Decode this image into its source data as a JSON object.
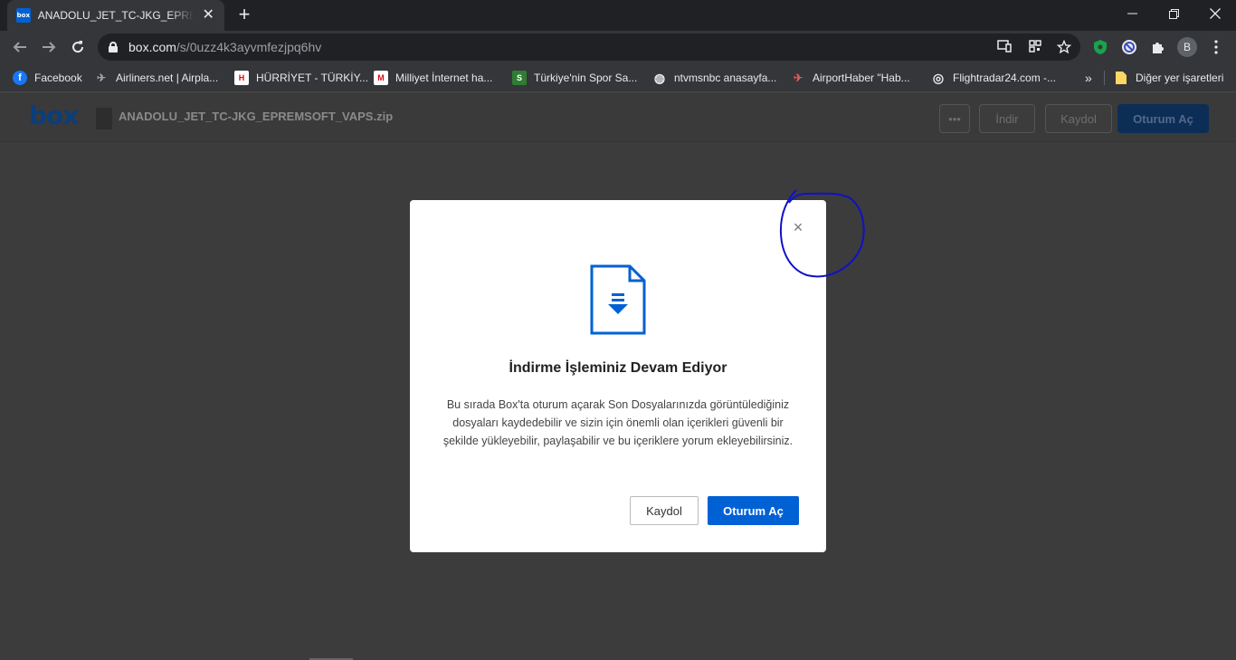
{
  "browser": {
    "tab_title": "ANADOLU_JET_TC-JKG_EPREMSOFT_VAPS.zip",
    "tab_favicon_text": "box",
    "new_tab_label": "+",
    "url_host": "box.com",
    "url_path": "/s/0uzz4k3ayvmfezjpq6hv",
    "avatar_letter": "B",
    "window_controls": {
      "minimize": "—",
      "maximize": "❐",
      "close": "✕"
    }
  },
  "bookmarks": [
    {
      "label": "Facebook",
      "icon": "facebook-icon",
      "color": "#1877f2",
      "glyph": "f"
    },
    {
      "label": "Airliners.net | Airpla...",
      "icon": "airliners-icon",
      "color": "#35363a",
      "glyph": "✈"
    },
    {
      "label": "HÜRRİYET - TÜRKİY...",
      "icon": "hurriyet-icon",
      "color": "#e30613",
      "glyph": "H"
    },
    {
      "label": "Milliyet İnternet ha...",
      "icon": "milliyet-icon",
      "color": "#e30613",
      "glyph": "M"
    },
    {
      "label": "Türkiye'nin Spor Sa...",
      "icon": "spor-icon",
      "color": "#2e7d32",
      "glyph": "S"
    },
    {
      "label": "ntvmsnbc anasayfa...",
      "icon": "globe-icon",
      "color": "#5f6368",
      "glyph": "◍"
    },
    {
      "label": "AirportHaber \"Hab...",
      "icon": "airporthaber-icon",
      "color": "#35363a",
      "glyph": "✈"
    },
    {
      "label": "Flightradar24.com -...",
      "icon": "flightradar-icon",
      "color": "#35363a",
      "glyph": "◎"
    }
  ],
  "bookmarks_overflow": "»",
  "other_bookmarks": "Diğer yer işaretleri",
  "box_header": {
    "logo": "box",
    "file_name": "ANADOLU_JET_TC-JKG_EPREMSOFT_VAPS.zip",
    "more_label": "•••",
    "download_label": "İndir",
    "signup_label": "Kaydol",
    "login_label": "Oturum Aç"
  },
  "modal": {
    "close_label": "×",
    "title": "İndirme İşleminiz Devam Ediyor",
    "body": "Bu sırada Box'ta oturum açarak Son Dosyalarınızda görüntülediğiniz dosyaları kaydedebilir ve sizin için önemli olan içerikleri güvenli bir şekilde yükleyebilir, paylaşabilir ve bu içeriklere yorum ekleyebilirsiniz.",
    "secondary_label": "Kaydol",
    "primary_label": "Oturum Aç"
  },
  "colors": {
    "box_blue": "#0061d5",
    "annotation": "#1010c8"
  }
}
